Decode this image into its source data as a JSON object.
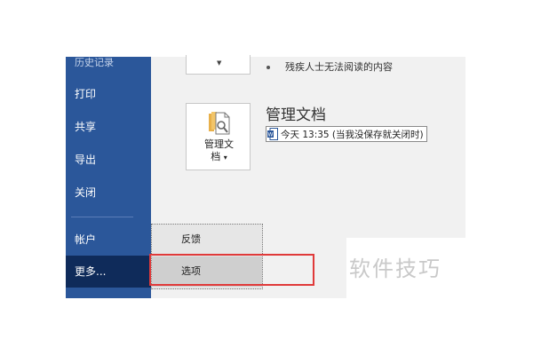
{
  "sidebar": {
    "items": [
      {
        "label": "历史记录"
      },
      {
        "label": "打印"
      },
      {
        "label": "共享"
      },
      {
        "label": "导出"
      },
      {
        "label": "关闭"
      },
      {
        "label": "帐户"
      },
      {
        "label": "更多..."
      }
    ]
  },
  "info": {
    "accessibility_text": "残疾人士无法阅读的内容",
    "manage_button_line1": "管理文",
    "manage_button_line2": "档",
    "manage_button_caret": "▾",
    "manage_title": "管理文档",
    "version_text": "今天 13:35 (当我没保存就关闭时)"
  },
  "menu": {
    "items": [
      {
        "label": "反馈"
      },
      {
        "label": "选项"
      }
    ]
  },
  "watermark": "软件技巧",
  "colors": {
    "sidebar": "#2b579a",
    "sidebar_active": "#0f2b5a",
    "highlight": "#e03a3a"
  },
  "icons": {
    "top_card": "chevron-down-icon",
    "manage": "manage-document-icon",
    "version": "word-document-icon"
  }
}
